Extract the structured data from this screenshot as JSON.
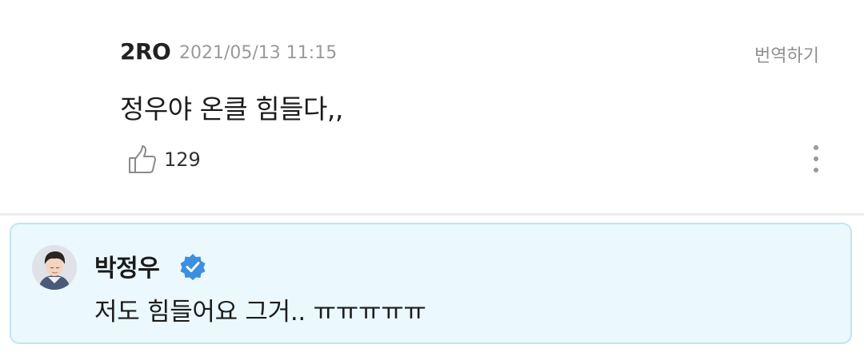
{
  "comment": {
    "author": "2RO",
    "timestamp": "2021/05/13 11:15",
    "translate_label": "번역하기",
    "text": "정우야 온클 힘들다,,",
    "like_count": "129",
    "like_icon": "thumbs-up-icon",
    "more_icon": "more-vertical-icon"
  },
  "reply": {
    "author": "박정우",
    "verified_icon": "verified-badge-icon",
    "text": "저도 힘들어요 그거.. ㅠㅠㅠㅠㅠ"
  },
  "colors": {
    "reply_background": "#ebf8fd",
    "reply_border": "#bfe5f3",
    "verified_badge": "#3d8fe0",
    "timestamp": "#9a9a9a"
  }
}
